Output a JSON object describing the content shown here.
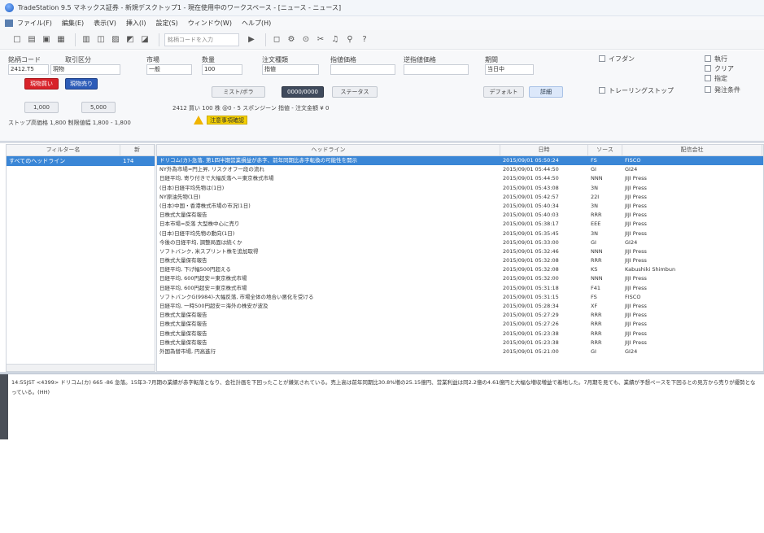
{
  "window": {
    "title": "TradeStation 9.5 マネックス証券 - 新規デスクトップ1 - 現在使用中のワークスペース - [ニュース - ニュース]"
  },
  "menu": {
    "items": [
      "ファイル(F)",
      "編集(E)",
      "表示(V)",
      "挿入(I)",
      "設定(S)",
      "ウィンドウ(W)",
      "ヘルプ(H)"
    ]
  },
  "toolbar": {
    "symbol_placeholder": "銘柄コードを入力"
  },
  "order": {
    "labels": {
      "symbol": "銘柄コード",
      "account": "取引区分",
      "market": "市場",
      "qty": "数量",
      "order_type": "注文種類",
      "price_cond": "指値価格",
      "trigger": "逆指値価格",
      "period": "期間"
    },
    "values": {
      "symbol": "2412.T5",
      "account": "現物",
      "market": "一般",
      "qty": "100",
      "order_type": "指値",
      "period": "当日中"
    },
    "buttons": {
      "buy": "現物買い",
      "sell": "現物売り",
      "preset1": "ミスト/ボラ",
      "tick1": "1,000",
      "tick2": "5,000",
      "dark": "0000/0000",
      "status": "ステータス",
      "default": "デフォルト",
      "detail": "詳細"
    },
    "checkboxes": [
      "イフダン",
      "トレーリングストップ"
    ],
    "right_checks": [
      "執行",
      "クリア",
      "指定",
      "発注条件"
    ],
    "info_line": "2412 買い 100 株 @0 - 5 スポンジーン 指値 - 注文金額 ¥ 0",
    "bottom_info": "ストップ高価格 1,800 制限値幅 1,800 - 1,800",
    "warning_badge": "注意事項確認"
  },
  "filter": {
    "headers": [
      "フィルター名",
      "新"
    ],
    "row": {
      "name": "すべてのヘッドライン",
      "count": "174"
    }
  },
  "news": {
    "headers": [
      "ヘッドライン",
      "日時",
      "ソース",
      "配信会社"
    ],
    "rows": [
      {
        "headline": "ドリコム(カ)-急落, 第1四半期営業損益が赤字、前年同期比赤字転換の可能性を開示",
        "date": "2015/09/01 05:50:24",
        "src": "FS",
        "dist": "FISCO",
        "selected": true
      },
      {
        "headline": "NY外為市場=円上昇, リスクオフ一段の流れ",
        "date": "2015/09/01 05:44:50",
        "src": "GI",
        "dist": "GI24",
        "selected": false
      },
      {
        "headline": "日経平均, 寄り付きで大幅反落へ＝東京株式市場",
        "date": "2015/09/01 05:44:50",
        "src": "NNN",
        "dist": "JIJI Press",
        "selected": false
      },
      {
        "headline": "(日本)日経平均先物は(1日)",
        "date": "2015/09/01 05:43:08",
        "src": "3N",
        "dist": "JIJI Press",
        "selected": false
      },
      {
        "headline": "NY原油先物(1日)",
        "date": "2015/09/01 05:42:57",
        "src": "22I",
        "dist": "JIJI Press",
        "selected": false
      },
      {
        "headline": "(日本)中国・香港株式市場の市況(1日)",
        "date": "2015/09/01 05:40:34",
        "src": "3N",
        "dist": "JIJI Press",
        "selected": false
      },
      {
        "headline": "日株式大量保有報告",
        "date": "2015/09/01 05:40:03",
        "src": "RRR",
        "dist": "JIJI Press",
        "selected": false
      },
      {
        "headline": "日本市場=反落 大型株中心に売り",
        "date": "2015/09/01 05:38:17",
        "src": "EEE",
        "dist": "JIJI Press",
        "selected": false
      },
      {
        "headline": "(日本)日経平均先物の動向(1日)",
        "date": "2015/09/01 05:35:45",
        "src": "3N",
        "dist": "JIJI Press",
        "selected": false
      },
      {
        "headline": "今後の日経平均, 調整局面は続くか",
        "date": "2015/09/01 05:33:00",
        "src": "GI",
        "dist": "GI24",
        "selected": false
      },
      {
        "headline": "ソフトバンク, 米スプリント株を追加取得",
        "date": "2015/09/01 05:32:46",
        "src": "NNN",
        "dist": "JIJI Press",
        "selected": false
      },
      {
        "headline": "日株式大量保有報告",
        "date": "2015/09/01 05:32:08",
        "src": "RRR",
        "dist": "JIJI Press",
        "selected": false
      },
      {
        "headline": "日経平均, 下げ幅500円超える",
        "date": "2015/09/01 05:32:08",
        "src": "KS",
        "dist": "Kabushiki Shimbun",
        "selected": false
      },
      {
        "headline": "日経平均, 600円超安＝東京株式市場",
        "date": "2015/09/01 05:32:00",
        "src": "NNN",
        "dist": "JIJI Press",
        "selected": false
      },
      {
        "headline": "日経平均, 600円超安＝東京株式市場",
        "date": "2015/09/01 05:31:18",
        "src": "F41",
        "dist": "JIJI Press",
        "selected": false
      },
      {
        "headline": "ソフトバンクG(9984)-大幅反落, 市場全体の地合い悪化を受ける",
        "date": "2015/09/01 05:31:15",
        "src": "FS",
        "dist": "FISCO",
        "selected": false
      },
      {
        "headline": "日経平均, 一時500円超安＝海外の株安が波及",
        "date": "2015/09/01 05:28:34",
        "src": "XF",
        "dist": "JIJI Press",
        "selected": false
      },
      {
        "headline": "日株式大量保有報告",
        "date": "2015/09/01 05:27:29",
        "src": "RRR",
        "dist": "JIJI Press",
        "selected": false
      },
      {
        "headline": "日株式大量保有報告",
        "date": "2015/09/01 05:27:26",
        "src": "RRR",
        "dist": "JIJI Press",
        "selected": false
      },
      {
        "headline": "日株式大量保有報告",
        "date": "2015/09/01 05:23:38",
        "src": "RRR",
        "dist": "JIJI Press",
        "selected": false
      },
      {
        "headline": "日株式大量保有報告",
        "date": "2015/09/01 05:23:38",
        "src": "RRR",
        "dist": "JIJI Press",
        "selected": false
      },
      {
        "headline": "外国為替市場, 円高進行",
        "date": "2015/09/01 05:21:00",
        "src": "GI",
        "dist": "GI24",
        "selected": false
      }
    ]
  },
  "story": {
    "text": "14:55JST <4399> ドリコム(カ) 665 -86 急落。15年3-7月期の業績が赤字転落となり、会社計画を下回ったことが嫌気されている。売上高は前年同期比30.8%増の25.15億円、営業利益は同2.2億の4.61億円と大幅な増収増益で着地した。7月期を見ても、業績が予想ペースを下回るとの見方から売りが優勢となっている。(HH)"
  }
}
